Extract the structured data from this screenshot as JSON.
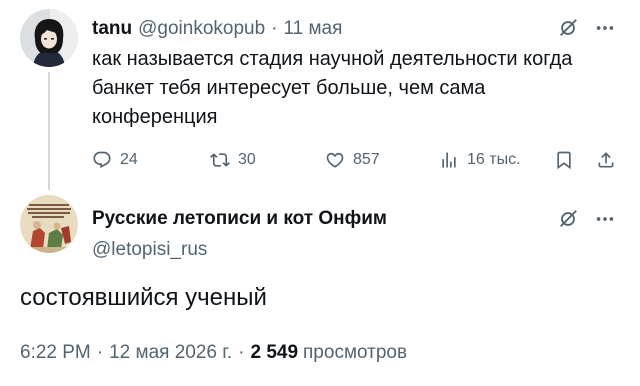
{
  "colors": {
    "text": "#0f1419",
    "secondary": "#536471",
    "thread_line": "#cfd9de",
    "background": "#ffffff"
  },
  "parent_tweet": {
    "author_name": "tanu",
    "author_handle": "@goinkokopub",
    "separator": "·",
    "date": "11 мая",
    "header_icons": [
      "grok-icon",
      "more-icon"
    ],
    "text_lines": [
      "как называется стадия научной деятельности когда",
      "банкет тебя интересует больше, чем сама",
      "конференция"
    ],
    "actions": [
      {
        "icon": "reply-icon",
        "count": "24"
      },
      {
        "icon": "repost-icon",
        "count": "30"
      },
      {
        "icon": "like-icon",
        "count": "857"
      },
      {
        "icon": "views-icon",
        "count": "16 тыс."
      },
      {
        "icon": "bookmark-icon"
      },
      {
        "icon": "share-icon"
      }
    ]
  },
  "main_tweet": {
    "author_name": "Русские летописи и кот Онфим",
    "author_handle": "@letopisi_rus",
    "header_icons": [
      "grok-icon",
      "more-icon"
    ],
    "text": "состоявшийся ученый",
    "meta": {
      "time": "6:22 PM",
      "separator": "·",
      "date": "12 мая 2026 г.",
      "views_count": "2 549",
      "views_label": "просмотров"
    }
  }
}
